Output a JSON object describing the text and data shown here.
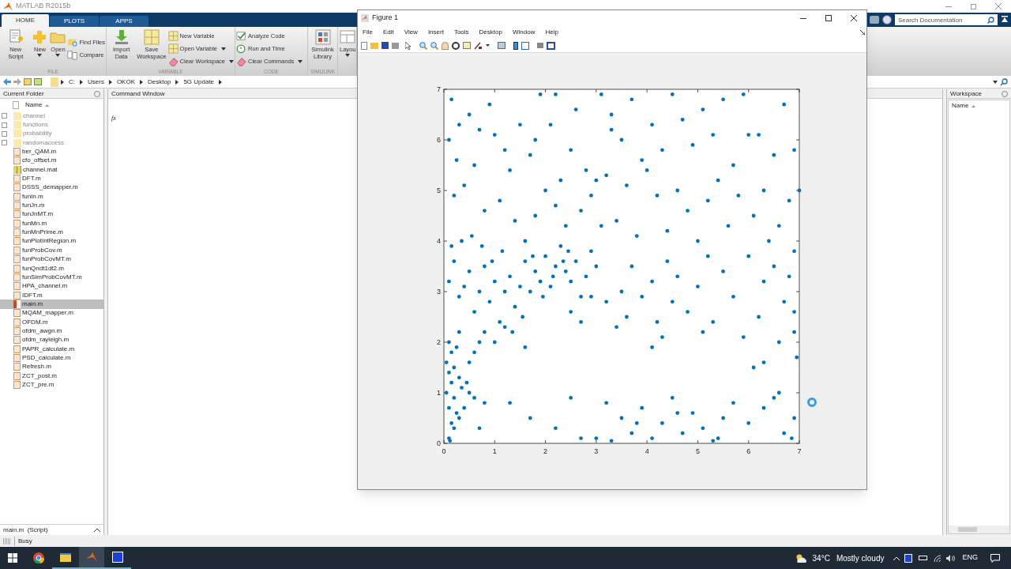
{
  "app": {
    "title": "MATLAB R2015b"
  },
  "ribbon_tabs": [
    {
      "label": "HOME",
      "selected": true
    },
    {
      "label": "PLOTS",
      "selected": false
    },
    {
      "label": "APPS",
      "selected": false
    }
  ],
  "search": {
    "placeholder": "Search Documentation"
  },
  "ribbon_groups": [
    {
      "label": "FILE",
      "items": [
        {
          "kind": "large",
          "label": "New Script",
          "dropdown": false
        },
        {
          "kind": "large",
          "label": "New",
          "dropdown": true
        },
        {
          "kind": "large",
          "label": "Open",
          "dropdown": true
        },
        {
          "kind": "stack",
          "entries": [
            {
              "label": "Find Files",
              "dropdown": false
            },
            {
              "label": "Compare",
              "dropdown": false
            }
          ]
        }
      ]
    },
    {
      "label": "VARIABLE",
      "items": [
        {
          "kind": "large",
          "label": "Import Data",
          "dropdown": false
        },
        {
          "kind": "large",
          "label": "Save Workspace",
          "dropdown": false
        },
        {
          "kind": "stack",
          "entries": [
            {
              "label": "New Variable",
              "dropdown": false
            },
            {
              "label": "Open Variable",
              "dropdown": true
            },
            {
              "label": "Clear Workspace",
              "dropdown": true
            }
          ]
        }
      ]
    },
    {
      "label": "CODE",
      "items": [
        {
          "kind": "stack",
          "entries": [
            {
              "label": "Analyze Code",
              "dropdown": false
            },
            {
              "label": "Run and Time",
              "dropdown": false
            },
            {
              "label": "Clear Commands",
              "dropdown": true
            }
          ]
        }
      ]
    },
    {
      "label": "SIMULINK",
      "items": [
        {
          "kind": "large",
          "label": "Simulink Library",
          "dropdown": false
        }
      ]
    },
    {
      "items": [
        {
          "kind": "large",
          "label": "Layou",
          "dropdown": true
        }
      ]
    }
  ],
  "address": {
    "segments": [
      "C:",
      "Users",
      "OKOK",
      "Desktop",
      "5G Update"
    ]
  },
  "current_folder": {
    "title": "Current Folder",
    "column": "Name",
    "items": [
      {
        "name": "channel",
        "kind": "folder",
        "selected": false
      },
      {
        "name": "functions",
        "kind": "folder",
        "selected": false
      },
      {
        "name": "probability",
        "kind": "folder",
        "selected": false
      },
      {
        "name": "randomaccess",
        "kind": "folder",
        "selected": false
      },
      {
        "name": "ber_QAM.m",
        "kind": "function",
        "selected": false
      },
      {
        "name": "cfo_offset.m",
        "kind": "function",
        "selected": false
      },
      {
        "name": "channel.mat",
        "kind": "data",
        "selected": false
      },
      {
        "name": "DFT.m",
        "kind": "function",
        "selected": false
      },
      {
        "name": "DSSS_demapper.m",
        "kind": "function",
        "selected": false
      },
      {
        "name": "funIn.m",
        "kind": "function",
        "selected": false
      },
      {
        "name": "funJn.m",
        "kind": "function",
        "selected": false
      },
      {
        "name": "funJnMT.m",
        "kind": "function",
        "selected": false
      },
      {
        "name": "funMn.m",
        "kind": "function",
        "selected": false
      },
      {
        "name": "funMnPrime.m",
        "kind": "function",
        "selected": false
      },
      {
        "name": "funPlotIntRegion.m",
        "kind": "function",
        "selected": false
      },
      {
        "name": "funProbCov.m",
        "kind": "function",
        "selected": false
      },
      {
        "name": "funProbCovMT.m",
        "kind": "function",
        "selected": false
      },
      {
        "name": "funQndt1dt2.m",
        "kind": "function",
        "selected": false
      },
      {
        "name": "funSimProbCovMT.m",
        "kind": "function",
        "selected": false
      },
      {
        "name": "HPA_channel.m",
        "kind": "function",
        "selected": false
      },
      {
        "name": "IDFT.m",
        "kind": "function",
        "selected": false
      },
      {
        "name": "main.m",
        "kind": "script",
        "selected": true
      },
      {
        "name": "MQAM_mapper.m",
        "kind": "function",
        "selected": false
      },
      {
        "name": "OFDM.m",
        "kind": "function",
        "selected": false
      },
      {
        "name": "ofdm_awgn.m",
        "kind": "function",
        "selected": false
      },
      {
        "name": "ofdm_rayleigh.m",
        "kind": "function",
        "selected": false
      },
      {
        "name": "PAPR_calculate.m",
        "kind": "function",
        "selected": false
      },
      {
        "name": "PSD_calculate.m",
        "kind": "function",
        "selected": false
      },
      {
        "name": "Refresh.m",
        "kind": "function",
        "selected": false
      },
      {
        "name": "ZCT_post.m",
        "kind": "function",
        "selected": false
      },
      {
        "name": "ZCT_pre.m",
        "kind": "function",
        "selected": false
      }
    ],
    "details": "main.m  (Script)"
  },
  "command_window": {
    "title": "Command Window",
    "prompt": "fx"
  },
  "workspace": {
    "title": "Workspace",
    "column": "Name"
  },
  "status_bar": {
    "text": "Busy"
  },
  "figure": {
    "title": "Figure 1",
    "menu": [
      "File",
      "Edit",
      "View",
      "Insert",
      "Tools",
      "Desktop",
      "Window",
      "Help"
    ],
    "axes": {
      "x_ticks": [
        "0",
        "1",
        "2",
        "3",
        "4",
        "5",
        "6",
        "7"
      ],
      "y_ticks": [
        "7",
        "6",
        "5",
        "4",
        "3",
        "2",
        "1",
        "0"
      ]
    }
  },
  "taskbar": {
    "temperature": "34°C",
    "weather": "Mostly cloudy",
    "language": "ENG"
  }
}
